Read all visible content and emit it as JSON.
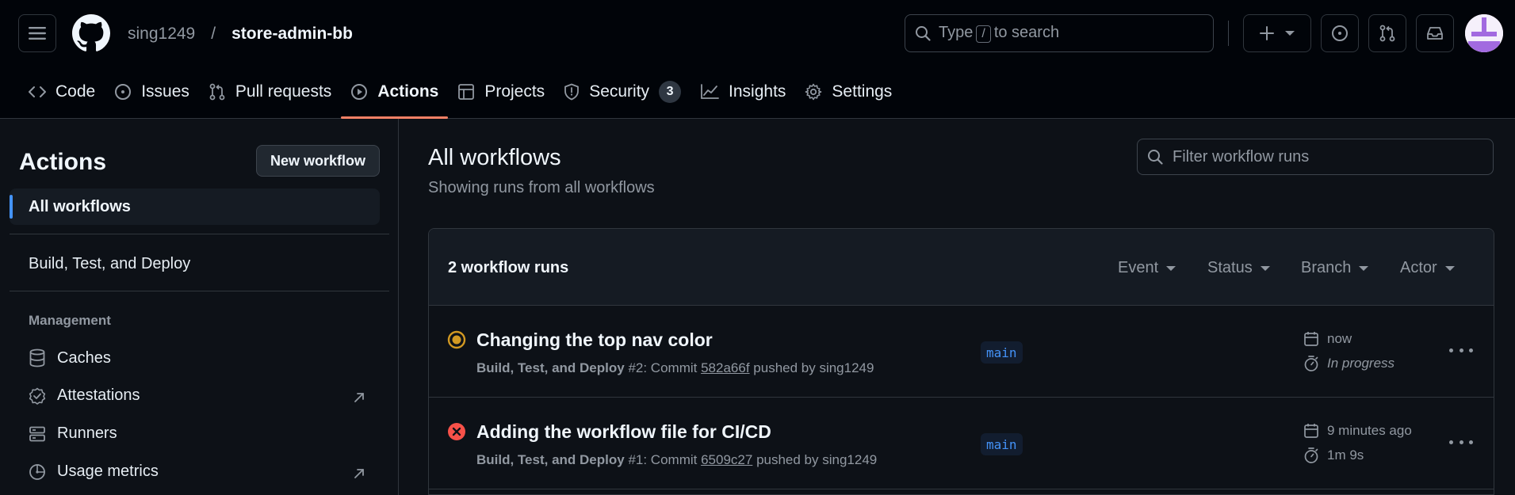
{
  "header": {
    "owner": "sing1249",
    "separator": "/",
    "repo": "store-admin-bb",
    "search": {
      "prefix": "Type",
      "key": "/",
      "suffix": "to search"
    }
  },
  "repo_nav": {
    "tabs": [
      {
        "label": "Code",
        "icon": "code-icon"
      },
      {
        "label": "Issues",
        "icon": "issue-opened-icon"
      },
      {
        "label": "Pull requests",
        "icon": "git-pull-request-icon"
      },
      {
        "label": "Actions",
        "icon": "play-icon",
        "active": true
      },
      {
        "label": "Projects",
        "icon": "table-icon"
      },
      {
        "label": "Security",
        "icon": "shield-icon",
        "counter": "3"
      },
      {
        "label": "Insights",
        "icon": "graph-icon"
      },
      {
        "label": "Settings",
        "icon": "gear-icon"
      }
    ]
  },
  "sidebar": {
    "title": "Actions",
    "new_workflow": "New workflow",
    "all_workflows": "All workflows",
    "workflow": "Build, Test, and Deploy",
    "management_heading": "Management",
    "management_items": [
      {
        "label": "Caches",
        "icon": "database-icon"
      },
      {
        "label": "Attestations",
        "icon": "verified-icon"
      },
      {
        "label": "Runners",
        "icon": "server-icon"
      },
      {
        "label": "Usage metrics",
        "icon": "meter-icon"
      }
    ]
  },
  "main": {
    "title": "All workflows",
    "subtitle": "Showing runs from all workflows",
    "filter_placeholder": "Filter workflow runs",
    "runs_count": "2 workflow runs",
    "filters": {
      "event": "Event",
      "status": "Status",
      "branch": "Branch",
      "actor": "Actor"
    },
    "runs": [
      {
        "status": "in-progress",
        "title": "Changing the top nav color",
        "workflow": "Build, Test, and Deploy",
        "run_number": "#2",
        "commit_prefix": ": Commit",
        "commit": "582a66f",
        "pushed_by": "pushed by sing1249",
        "branch": "main",
        "when": "now",
        "duration": "In progress"
      },
      {
        "status": "failure",
        "title": "Adding the workflow file for CI/CD",
        "workflow": "Build, Test, and Deploy",
        "run_number": "#1",
        "commit_prefix": ": Commit",
        "commit": "6509c27",
        "pushed_by": "pushed by sing1249",
        "branch": "main",
        "when": "9 minutes ago",
        "duration": "1m 9s"
      }
    ]
  },
  "colors": {
    "header_bg": "#010409",
    "page_bg": "#0d1117",
    "active_tab_underline": "#f78166",
    "accent_blue": "#4493f8",
    "in_progress": "#d29922",
    "failure": "#f85149"
  }
}
